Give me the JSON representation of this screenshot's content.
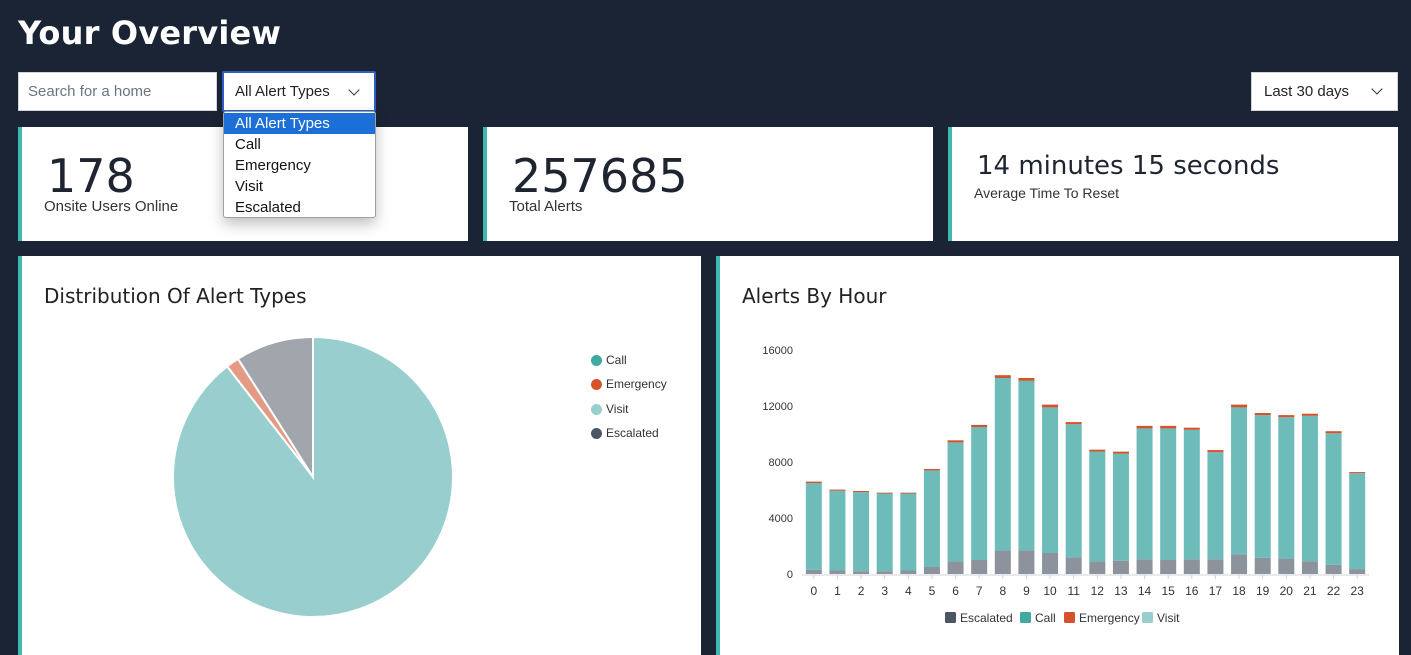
{
  "page": {
    "title": "Your Overview"
  },
  "filters": {
    "search_placeholder": "Search for a home",
    "alert_type_selected": "All Alert Types",
    "alert_type_options": [
      "All Alert Types",
      "Call",
      "Emergency",
      "Visit",
      "Escalated"
    ],
    "date_range_selected": "Last 30 days"
  },
  "stats": {
    "onsite_users": {
      "value": "178",
      "label": "Onsite Users Online"
    },
    "total_alerts": {
      "value": "257685",
      "label": "Total Alerts"
    },
    "avg_reset": {
      "value": "14 minutes 15 seconds",
      "label": "Average Time To Reset"
    }
  },
  "colors": {
    "call": "#3fa9a2",
    "emergency": "#d4532b",
    "visit": "#98cfce",
    "escalated": "#4b5563",
    "pie_emergency": "#e59a86",
    "pie_escalated": "#a1a6ad",
    "accent": "#3fb8b0",
    "bar_escalated": "#8c939c",
    "bar_call": "#6dbcba"
  },
  "chart_data": [
    {
      "type": "pie",
      "title": "Distribution Of Alert Types",
      "legend": [
        "Call",
        "Emergency",
        "Visit",
        "Escalated"
      ],
      "legend_position": "right",
      "slices": [
        {
          "name": "Visit",
          "value": 89.5
        },
        {
          "name": "Emergency",
          "value": 1.5
        },
        {
          "name": "Escalated",
          "value": 9.0
        },
        {
          "name": "Call",
          "value": 0.0
        }
      ]
    },
    {
      "type": "bar",
      "stacked": true,
      "title": "Alerts By Hour",
      "categories": [
        "0",
        "1",
        "2",
        "3",
        "4",
        "5",
        "6",
        "7",
        "8",
        "9",
        "10",
        "11",
        "12",
        "13",
        "14",
        "15",
        "16",
        "17",
        "18",
        "19",
        "20",
        "21",
        "22",
        "23"
      ],
      "y_ticks": [
        "0",
        "4000",
        "8000",
        "12000",
        "16000"
      ],
      "ylim": [
        0,
        16000
      ],
      "legend": [
        "Escalated",
        "Call",
        "Emergency",
        "Visit"
      ],
      "legend_position": "bottom",
      "series": [
        {
          "name": "Escalated",
          "values": [
            300,
            250,
            200,
            200,
            250,
            500,
            900,
            1000,
            1700,
            1700,
            1500,
            1200,
            900,
            950,
            1050,
            1000,
            1050,
            1050,
            1400,
            1150,
            1100,
            900,
            650,
            350
          ]
        },
        {
          "name": "Call",
          "values": [
            6200,
            5700,
            5650,
            5550,
            5500,
            6900,
            8500,
            9500,
            12300,
            12100,
            10400,
            9500,
            7850,
            7650,
            9350,
            9400,
            9250,
            7650,
            10500,
            10200,
            10100,
            10400,
            9400,
            6850
          ]
        },
        {
          "name": "Emergency",
          "values": [
            100,
            80,
            80,
            60,
            60,
            100,
            150,
            150,
            200,
            200,
            200,
            150,
            130,
            140,
            180,
            180,
            150,
            150,
            200,
            150,
            150,
            150,
            150,
            80
          ]
        },
        {
          "name": "Visit",
          "values": [
            0,
            0,
            0,
            0,
            0,
            0,
            0,
            0,
            0,
            0,
            0,
            0,
            0,
            0,
            0,
            0,
            0,
            0,
            0,
            0,
            0,
            0,
            0,
            0
          ]
        }
      ]
    }
  ]
}
